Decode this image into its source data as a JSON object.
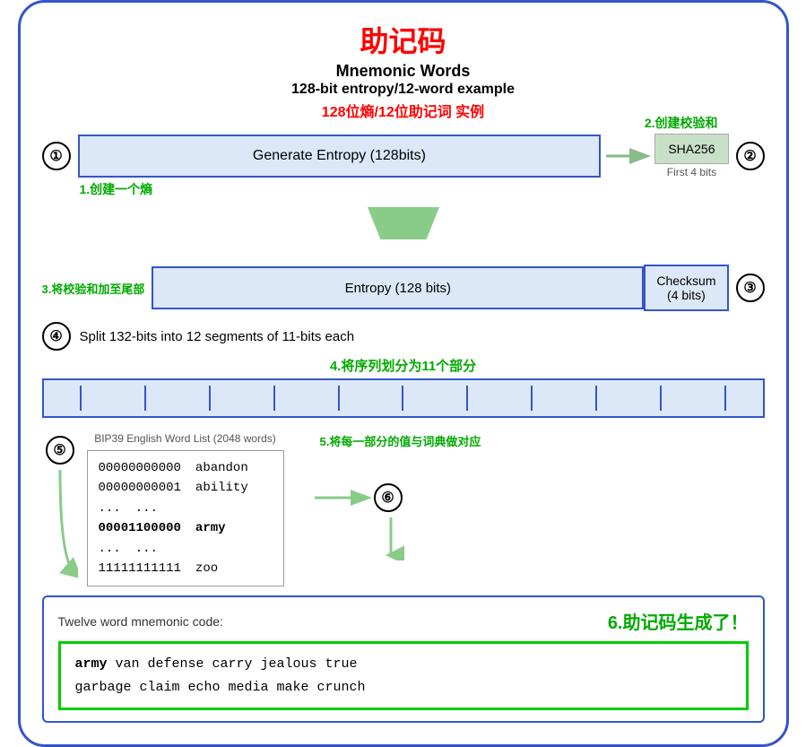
{
  "title_cn": "助记码",
  "title_en": "Mnemonic Words",
  "subtitle_en": "128-bit entropy/12-word example",
  "subtitle_cn": "128位熵/12位助记词 实例",
  "label_2": "2.创建校验和",
  "step1": {
    "circle": "①",
    "box_text": "Generate Entropy (128bits)",
    "label": "1.创建一个熵"
  },
  "sha256": "SHA256",
  "first4bits": "First 4 bits",
  "circle2": "②",
  "label_3": "3.将校验和加至尾部",
  "entropy128": "Entropy (128 bits)",
  "checksum": "Checksum\n(4 bits)",
  "circle3": "③",
  "step4": {
    "circle": "④",
    "text": "Split 132-bits into 12 segments of 11-bits each",
    "label": "4.将序列划分为11个部分"
  },
  "circle5": "⑤",
  "bip39_title": "BIP39 English Word List (2048 words)",
  "bip39_rows": [
    {
      "bits": "00000000000",
      "word": "abandon"
    },
    {
      "bits": "00000000001",
      "word": "ability"
    },
    {
      "bits": "...",
      "word": "..."
    },
    {
      "bits": "00001100000",
      "word": "army",
      "highlight": true
    },
    {
      "bits": "...",
      "word": "..."
    },
    {
      "bits": "11111111111",
      "word": "zoo"
    }
  ],
  "label_5": "5.将每一部分的值与词典做对应",
  "circle6": "⑥",
  "twelve_word_label": "Twelve word mnemonic code:",
  "label_6": "6.助记码生成了！",
  "mnemonic_word1": "army",
  "mnemonic_rest": " van defense carry jealous true\ngarbage claim echo media make crunch"
}
